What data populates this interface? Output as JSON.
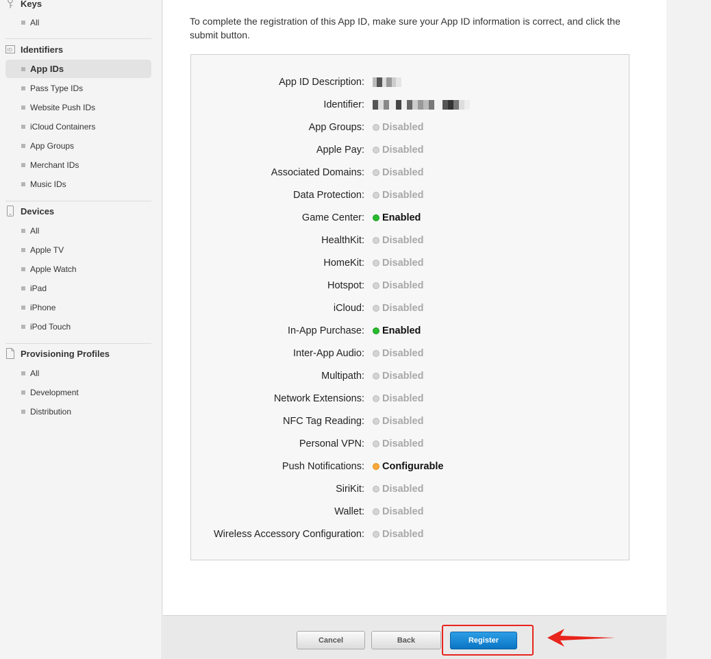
{
  "sidebar": {
    "keys": {
      "title": "Keys",
      "icon": "key-icon",
      "items": [
        {
          "label": "All"
        }
      ]
    },
    "identifiers": {
      "title": "Identifiers",
      "icon": "id-icon",
      "items": [
        {
          "label": "App IDs",
          "active": true
        },
        {
          "label": "Pass Type IDs"
        },
        {
          "label": "Website Push IDs"
        },
        {
          "label": "iCloud Containers"
        },
        {
          "label": "App Groups"
        },
        {
          "label": "Merchant IDs"
        },
        {
          "label": "Music IDs"
        }
      ]
    },
    "devices": {
      "title": "Devices",
      "icon": "device-icon",
      "items": [
        {
          "label": "All"
        },
        {
          "label": "Apple TV"
        },
        {
          "label": "Apple Watch"
        },
        {
          "label": "iPad"
        },
        {
          "label": "iPhone"
        },
        {
          "label": "iPod Touch"
        }
      ]
    },
    "profiles": {
      "title": "Provisioning Profiles",
      "icon": "document-icon",
      "items": [
        {
          "label": "All"
        },
        {
          "label": "Development"
        },
        {
          "label": "Distribution"
        }
      ]
    }
  },
  "main": {
    "intro": "To complete the registration of this App ID, make sure your App ID information is correct, and click the submit button.",
    "description_label": "App ID Description:",
    "identifier_label": "Identifier:",
    "capabilities": [
      {
        "label": "App Groups:",
        "status": "Disabled",
        "state": "disabled"
      },
      {
        "label": "Apple Pay:",
        "status": "Disabled",
        "state": "disabled"
      },
      {
        "label": "Associated Domains:",
        "status": "Disabled",
        "state": "disabled"
      },
      {
        "label": "Data Protection:",
        "status": "Disabled",
        "state": "disabled"
      },
      {
        "label": "Game Center:",
        "status": "Enabled",
        "state": "enabled"
      },
      {
        "label": "HealthKit:",
        "status": "Disabled",
        "state": "disabled"
      },
      {
        "label": "HomeKit:",
        "status": "Disabled",
        "state": "disabled"
      },
      {
        "label": "Hotspot:",
        "status": "Disabled",
        "state": "disabled"
      },
      {
        "label": "iCloud:",
        "status": "Disabled",
        "state": "disabled"
      },
      {
        "label": "In-App Purchase:",
        "status": "Enabled",
        "state": "enabled"
      },
      {
        "label": "Inter-App Audio:",
        "status": "Disabled",
        "state": "disabled"
      },
      {
        "label": "Multipath:",
        "status": "Disabled",
        "state": "disabled"
      },
      {
        "label": "Network Extensions:",
        "status": "Disabled",
        "state": "disabled"
      },
      {
        "label": "NFC Tag Reading:",
        "status": "Disabled",
        "state": "disabled"
      },
      {
        "label": "Personal VPN:",
        "status": "Disabled",
        "state": "disabled"
      },
      {
        "label": "Push Notifications:",
        "status": "Configurable",
        "state": "configurable"
      },
      {
        "label": "SiriKit:",
        "status": "Disabled",
        "state": "disabled"
      },
      {
        "label": "Wallet:",
        "status": "Disabled",
        "state": "disabled"
      },
      {
        "label": "Wireless Accessory Configuration:",
        "status": "Disabled",
        "state": "disabled"
      }
    ]
  },
  "footer": {
    "cancel_label": "Cancel",
    "back_label": "Back",
    "register_label": "Register"
  },
  "colors": {
    "enabled": "#29bb2e",
    "disabled": "#d4d4d4",
    "configurable": "#f7a93a",
    "register_button": "#1a8ad6",
    "annotation": "#e8241c"
  }
}
